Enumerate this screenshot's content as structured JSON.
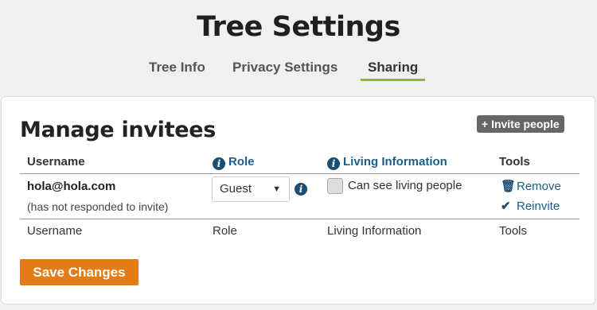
{
  "header": {
    "title": "Tree Settings"
  },
  "tabs": [
    {
      "label": "Tree Info"
    },
    {
      "label": "Privacy Settings"
    },
    {
      "label": "Sharing"
    }
  ],
  "manage": {
    "heading": "Manage invitees",
    "invite_label": "+ Invite people",
    "columns": {
      "username": "Username",
      "role": "Role",
      "living": "Living Information",
      "tools": "Tools"
    },
    "rows": [
      {
        "email": "hola@hola.com",
        "status": "(has not responded to invite)",
        "role": "Guest",
        "living_label": "Can see living people",
        "remove_label": "Remove",
        "reinvite_label": "Reinvite"
      }
    ],
    "footer": {
      "username": "Username",
      "role": "Role",
      "living": "Living Information",
      "tools": "Tools"
    },
    "save_label": "Save Changes"
  },
  "icons": {
    "info": "info-icon",
    "trash": "trash-icon",
    "check": "check-icon",
    "dropdown": "caret-down-icon"
  },
  "colors": {
    "tab_active_underline": "#8bb923",
    "link": "#1c5e8a",
    "save_button": "#e37b18",
    "invite_button": "#666666"
  }
}
